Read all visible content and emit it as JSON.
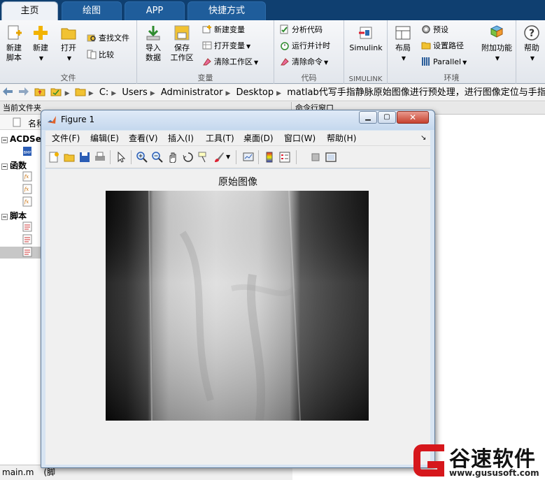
{
  "tabs": [
    {
      "label": "主页",
      "active": true
    },
    {
      "label": "绘图",
      "active": false
    },
    {
      "label": "APP",
      "active": false
    },
    {
      "label": "快捷方式",
      "active": false
    }
  ],
  "ribbon": {
    "file": {
      "label": "文件",
      "new_script_l1": "新建",
      "new_script_l2": "脚本",
      "new": "新建",
      "open": "打开",
      "find_files": "查找文件",
      "compare": "比较"
    },
    "variable": {
      "label": "变量",
      "import_l1": "导入",
      "import_l2": "数据",
      "save_l1": "保存",
      "save_l2": "工作区",
      "new_var": "新建变量",
      "open_var": "打开变量",
      "clear_ws": "清除工作区"
    },
    "code": {
      "label": "代码",
      "analyze": "分析代码",
      "run_time": "运行并计时",
      "clear_cmd": "清除命令"
    },
    "simulink": {
      "label": "SIMULINK",
      "btn": "Simulink"
    },
    "env": {
      "label": "环境",
      "layout": "布局",
      "prefs": "预设",
      "set_path": "设置路径",
      "parallel": "Parallel",
      "addons": "附加功能",
      "help": "帮助"
    }
  },
  "address": {
    "crumbs": [
      "C:",
      "Users",
      "Administrator",
      "Desktop",
      "matlab代写手指静脉原始图像进行预处理，进行图像定位与手指图像截取"
    ]
  },
  "left_panel": {
    "title": "当前文件夹",
    "col_name": "名称",
    "groups": [
      "ACDSe",
      "函数",
      "脚本"
    ],
    "status": "main.m",
    "status_extra": "(脚"
  },
  "right_panel": {
    "title": "命令行窗口"
  },
  "figure": {
    "title": "Figure 1",
    "menu": [
      "文件(F)",
      "编辑(E)",
      "查看(V)",
      "插入(I)",
      "工具(T)",
      "桌面(D)",
      "窗口(W)",
      "帮助(H)"
    ],
    "axes_title": "原始图像"
  },
  "watermark": {
    "text": "谷速软件",
    "url": "www.gususoft.com"
  },
  "colors": {
    "tab_bar": "#0f3f70",
    "watermark_red": "#d6171c"
  }
}
